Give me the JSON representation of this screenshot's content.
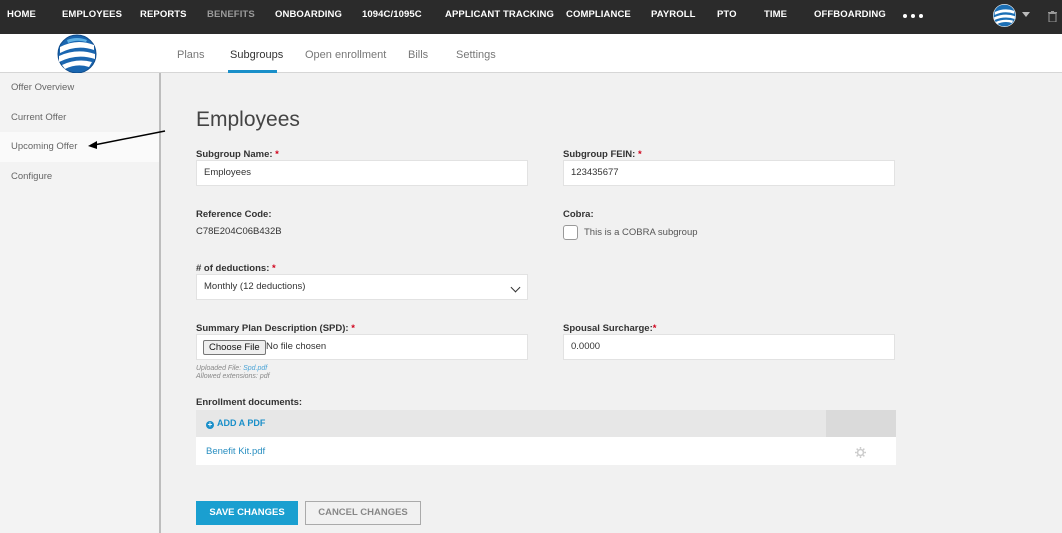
{
  "topnav": {
    "items": [
      "HOME",
      "EMPLOYEES",
      "REPORTS",
      "BENEFITS",
      "ONBOARDING",
      "1094C/1095C",
      "APPLICANT TRACKING",
      "COMPLIANCE",
      "PAYROLL",
      "PTO",
      "TIME",
      "OFFBOARDING"
    ],
    "active": "BENEFITS"
  },
  "subnav": {
    "tabs": [
      "Plans",
      "Subgroups",
      "Open enrollment",
      "Bills",
      "Settings"
    ],
    "active": "Subgroups"
  },
  "sidebar": {
    "items": [
      "Offer Overview",
      "Current Offer",
      "Upcoming Offer",
      "Configure"
    ],
    "active": "Upcoming Offer"
  },
  "form": {
    "title": "Employees",
    "subgroup_name_label": "Subgroup Name:",
    "subgroup_name_value": "Employees",
    "fein_label": "Subgroup FEIN:",
    "fein_value": "123435677",
    "reference_label": "Reference Code:",
    "reference_value": "C78E204C06B432B",
    "cobra_label": "Cobra:",
    "cobra_checkbox_label": "This is a COBRA subgroup",
    "deductions_label": "# of deductions:",
    "deductions_value": "Monthly (12 deductions)",
    "spd_label": "Summary Plan Description (SPD):",
    "choose_file": "Choose File",
    "no_file": "No file chosen",
    "uploaded_prefix": "Uploaded File:",
    "uploaded_file": "Spd.pdf",
    "allowed": "Allowed extensions: pdf",
    "spousal_label": "Spousal Surcharge:",
    "spousal_value": "0.0000",
    "required_mark": "*"
  },
  "enrollment": {
    "label": "Enrollment documents:",
    "add_pdf": "ADD A PDF",
    "documents": [
      "Benefit Kit.pdf"
    ]
  },
  "buttons": {
    "save": "SAVE CHANGES",
    "cancel": "CANCEL CHANGES"
  },
  "colors": {
    "accent": "#1a9fd0",
    "nav_bg": "#2b2b2b",
    "required": "#d0021b"
  }
}
